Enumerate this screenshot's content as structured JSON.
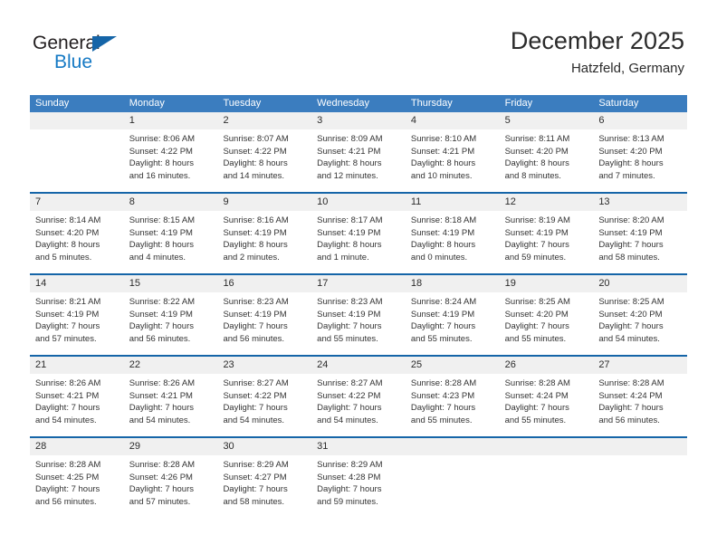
{
  "logo": {
    "word_top": "General",
    "word_bottom": "Blue",
    "triangle_color": "#1565a8",
    "blue_color": "#1579c4"
  },
  "header": {
    "title": "December 2025",
    "subtitle": "Hatzfeld, Germany"
  },
  "theme": {
    "header_blue": "#3b7dbf",
    "rule_blue": "#1565a8",
    "daynum_band": "#f0f0f0"
  },
  "weekdays": [
    "Sunday",
    "Monday",
    "Tuesday",
    "Wednesday",
    "Thursday",
    "Friday",
    "Saturday"
  ],
  "weeks": [
    {
      "days": [
        {
          "num": "",
          "l1": "",
          "l2": "",
          "l3": "",
          "l4": ""
        },
        {
          "num": "1",
          "l1": "Sunrise: 8:06 AM",
          "l2": "Sunset: 4:22 PM",
          "l3": "Daylight: 8 hours",
          "l4": "and 16 minutes."
        },
        {
          "num": "2",
          "l1": "Sunrise: 8:07 AM",
          "l2": "Sunset: 4:22 PM",
          "l3": "Daylight: 8 hours",
          "l4": "and 14 minutes."
        },
        {
          "num": "3",
          "l1": "Sunrise: 8:09 AM",
          "l2": "Sunset: 4:21 PM",
          "l3": "Daylight: 8 hours",
          "l4": "and 12 minutes."
        },
        {
          "num": "4",
          "l1": "Sunrise: 8:10 AM",
          "l2": "Sunset: 4:21 PM",
          "l3": "Daylight: 8 hours",
          "l4": "and 10 minutes."
        },
        {
          "num": "5",
          "l1": "Sunrise: 8:11 AM",
          "l2": "Sunset: 4:20 PM",
          "l3": "Daylight: 8 hours",
          "l4": "and 8 minutes."
        },
        {
          "num": "6",
          "l1": "Sunrise: 8:13 AM",
          "l2": "Sunset: 4:20 PM",
          "l3": "Daylight: 8 hours",
          "l4": "and 7 minutes."
        }
      ]
    },
    {
      "days": [
        {
          "num": "7",
          "l1": "Sunrise: 8:14 AM",
          "l2": "Sunset: 4:20 PM",
          "l3": "Daylight: 8 hours",
          "l4": "and 5 minutes."
        },
        {
          "num": "8",
          "l1": "Sunrise: 8:15 AM",
          "l2": "Sunset: 4:19 PM",
          "l3": "Daylight: 8 hours",
          "l4": "and 4 minutes."
        },
        {
          "num": "9",
          "l1": "Sunrise: 8:16 AM",
          "l2": "Sunset: 4:19 PM",
          "l3": "Daylight: 8 hours",
          "l4": "and 2 minutes."
        },
        {
          "num": "10",
          "l1": "Sunrise: 8:17 AM",
          "l2": "Sunset: 4:19 PM",
          "l3": "Daylight: 8 hours",
          "l4": "and 1 minute."
        },
        {
          "num": "11",
          "l1": "Sunrise: 8:18 AM",
          "l2": "Sunset: 4:19 PM",
          "l3": "Daylight: 8 hours",
          "l4": "and 0 minutes."
        },
        {
          "num": "12",
          "l1": "Sunrise: 8:19 AM",
          "l2": "Sunset: 4:19 PM",
          "l3": "Daylight: 7 hours",
          "l4": "and 59 minutes."
        },
        {
          "num": "13",
          "l1": "Sunrise: 8:20 AM",
          "l2": "Sunset: 4:19 PM",
          "l3": "Daylight: 7 hours",
          "l4": "and 58 minutes."
        }
      ]
    },
    {
      "days": [
        {
          "num": "14",
          "l1": "Sunrise: 8:21 AM",
          "l2": "Sunset: 4:19 PM",
          "l3": "Daylight: 7 hours",
          "l4": "and 57 minutes."
        },
        {
          "num": "15",
          "l1": "Sunrise: 8:22 AM",
          "l2": "Sunset: 4:19 PM",
          "l3": "Daylight: 7 hours",
          "l4": "and 56 minutes."
        },
        {
          "num": "16",
          "l1": "Sunrise: 8:23 AM",
          "l2": "Sunset: 4:19 PM",
          "l3": "Daylight: 7 hours",
          "l4": "and 56 minutes."
        },
        {
          "num": "17",
          "l1": "Sunrise: 8:23 AM",
          "l2": "Sunset: 4:19 PM",
          "l3": "Daylight: 7 hours",
          "l4": "and 55 minutes."
        },
        {
          "num": "18",
          "l1": "Sunrise: 8:24 AM",
          "l2": "Sunset: 4:19 PM",
          "l3": "Daylight: 7 hours",
          "l4": "and 55 minutes."
        },
        {
          "num": "19",
          "l1": "Sunrise: 8:25 AM",
          "l2": "Sunset: 4:20 PM",
          "l3": "Daylight: 7 hours",
          "l4": "and 55 minutes."
        },
        {
          "num": "20",
          "l1": "Sunrise: 8:25 AM",
          "l2": "Sunset: 4:20 PM",
          "l3": "Daylight: 7 hours",
          "l4": "and 54 minutes."
        }
      ]
    },
    {
      "days": [
        {
          "num": "21",
          "l1": "Sunrise: 8:26 AM",
          "l2": "Sunset: 4:21 PM",
          "l3": "Daylight: 7 hours",
          "l4": "and 54 minutes."
        },
        {
          "num": "22",
          "l1": "Sunrise: 8:26 AM",
          "l2": "Sunset: 4:21 PM",
          "l3": "Daylight: 7 hours",
          "l4": "and 54 minutes."
        },
        {
          "num": "23",
          "l1": "Sunrise: 8:27 AM",
          "l2": "Sunset: 4:22 PM",
          "l3": "Daylight: 7 hours",
          "l4": "and 54 minutes."
        },
        {
          "num": "24",
          "l1": "Sunrise: 8:27 AM",
          "l2": "Sunset: 4:22 PM",
          "l3": "Daylight: 7 hours",
          "l4": "and 54 minutes."
        },
        {
          "num": "25",
          "l1": "Sunrise: 8:28 AM",
          "l2": "Sunset: 4:23 PM",
          "l3": "Daylight: 7 hours",
          "l4": "and 55 minutes."
        },
        {
          "num": "26",
          "l1": "Sunrise: 8:28 AM",
          "l2": "Sunset: 4:24 PM",
          "l3": "Daylight: 7 hours",
          "l4": "and 55 minutes."
        },
        {
          "num": "27",
          "l1": "Sunrise: 8:28 AM",
          "l2": "Sunset: 4:24 PM",
          "l3": "Daylight: 7 hours",
          "l4": "and 56 minutes."
        }
      ]
    },
    {
      "days": [
        {
          "num": "28",
          "l1": "Sunrise: 8:28 AM",
          "l2": "Sunset: 4:25 PM",
          "l3": "Daylight: 7 hours",
          "l4": "and 56 minutes."
        },
        {
          "num": "29",
          "l1": "Sunrise: 8:28 AM",
          "l2": "Sunset: 4:26 PM",
          "l3": "Daylight: 7 hours",
          "l4": "and 57 minutes."
        },
        {
          "num": "30",
          "l1": "Sunrise: 8:29 AM",
          "l2": "Sunset: 4:27 PM",
          "l3": "Daylight: 7 hours",
          "l4": "and 58 minutes."
        },
        {
          "num": "31",
          "l1": "Sunrise: 8:29 AM",
          "l2": "Sunset: 4:28 PM",
          "l3": "Daylight: 7 hours",
          "l4": "and 59 minutes."
        },
        {
          "num": "",
          "l1": "",
          "l2": "",
          "l3": "",
          "l4": ""
        },
        {
          "num": "",
          "l1": "",
          "l2": "",
          "l3": "",
          "l4": ""
        },
        {
          "num": "",
          "l1": "",
          "l2": "",
          "l3": "",
          "l4": ""
        }
      ]
    }
  ]
}
